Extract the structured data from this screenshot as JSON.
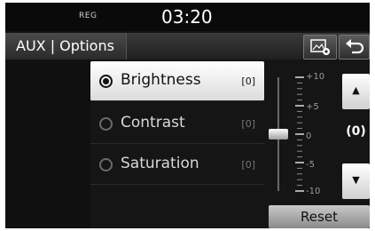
{
  "status": {
    "reg": "REG",
    "time": "03:20"
  },
  "header": {
    "title": "AUX | Options",
    "settings_icon": "screen-settings-icon",
    "back_icon": "back-arrow-icon"
  },
  "menu": {
    "items": [
      {
        "label": "Brightness",
        "value": "[0]",
        "selected": true
      },
      {
        "label": "Contrast",
        "value": "[0]",
        "selected": false
      },
      {
        "label": "Saturation",
        "value": "[0]",
        "selected": false
      }
    ]
  },
  "slider": {
    "scale_labels": [
      "+10",
      "+5",
      "0",
      "-5",
      "-10"
    ],
    "value": 0,
    "min": -10,
    "max": 10,
    "current_value_label": "(0)"
  },
  "controls": {
    "up_icon": "up-arrow-icon",
    "down_icon": "down-arrow-icon",
    "reset_label": "Reset"
  }
}
